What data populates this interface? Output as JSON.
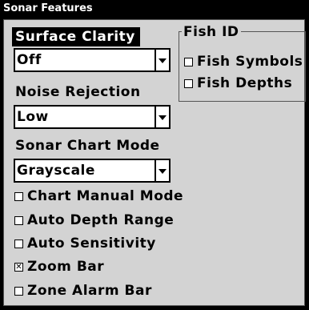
{
  "window": {
    "title": "Sonar Features"
  },
  "surface_clarity": {
    "label": "Surface Clarity",
    "value": "Off"
  },
  "noise_rejection": {
    "label": "Noise Rejection",
    "value": "Low"
  },
  "sonar_chart_mode": {
    "label": "Sonar Chart Mode",
    "value": "Grayscale"
  },
  "checkboxes": [
    {
      "label": "Chart Manual Mode",
      "checked": false
    },
    {
      "label": "Auto Depth Range",
      "checked": false
    },
    {
      "label": "Auto Sensitivity",
      "checked": false
    },
    {
      "label": "Zoom Bar",
      "checked": true
    },
    {
      "label": "Zone Alarm Bar",
      "checked": false
    }
  ],
  "fish_id": {
    "title": "Fish ID",
    "options": [
      {
        "label": "Fish Symbols",
        "checked": false
      },
      {
        "label": "Fish Depths",
        "checked": false
      }
    ]
  }
}
